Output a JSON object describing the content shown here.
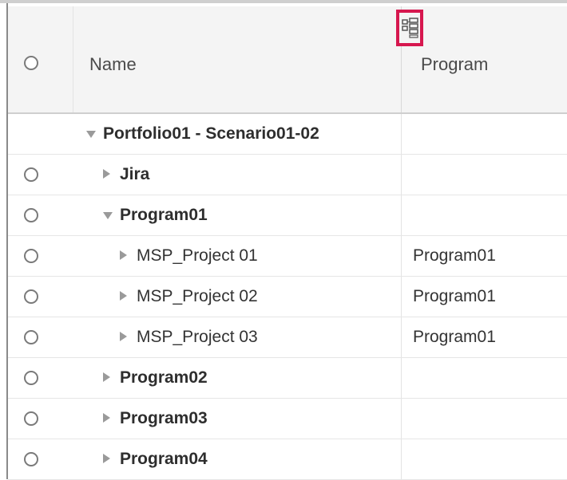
{
  "header": {
    "name_label": "Name",
    "program_label": "Program",
    "column_chooser_icon": "column-chooser-icon",
    "highlight_color": "#d6174e"
  },
  "rows": [
    {
      "name": "Portfolio01 - Scenario01-02",
      "program": "",
      "bold": true,
      "expanded": true,
      "has_radio": false
    },
    {
      "name": "Jira",
      "program": "",
      "bold": true,
      "expanded": false,
      "has_radio": true
    },
    {
      "name": "Program01",
      "program": "",
      "bold": true,
      "expanded": true,
      "has_radio": true
    },
    {
      "name": "MSP_Project 01",
      "program": "Program01",
      "bold": false,
      "expanded": false,
      "has_radio": true
    },
    {
      "name": "MSP_Project 02",
      "program": "Program01",
      "bold": false,
      "expanded": false,
      "has_radio": true
    },
    {
      "name": "MSP_Project 03",
      "program": "Program01",
      "bold": false,
      "expanded": false,
      "has_radio": true
    },
    {
      "name": "Program02",
      "program": "",
      "bold": true,
      "expanded": false,
      "has_radio": true
    },
    {
      "name": "Program03",
      "program": "",
      "bold": true,
      "expanded": false,
      "has_radio": true
    },
    {
      "name": "Program04",
      "program": "",
      "bold": true,
      "expanded": false,
      "has_radio": true
    }
  ]
}
